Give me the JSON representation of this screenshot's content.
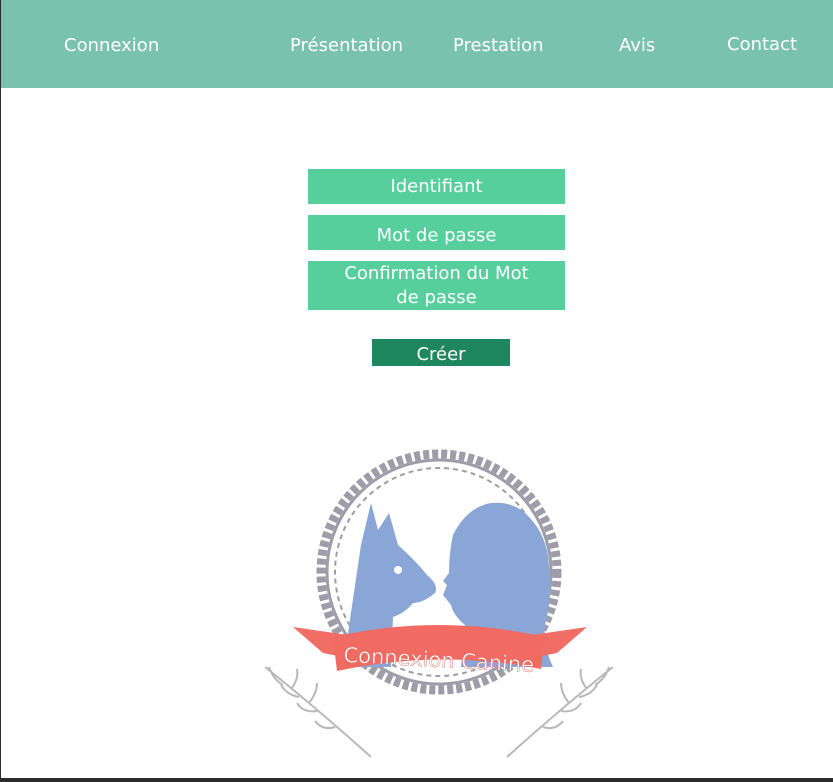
{
  "nav": {
    "items": [
      "Connexion",
      "Présentation",
      "Prestation",
      "Avis",
      "Contact"
    ]
  },
  "form": {
    "identifiant": "Identifiant",
    "mot_de_passe": "Mot de passe",
    "confirmation": "Confirmation du Mot de passe",
    "submit_label": "Créer"
  },
  "logo": {
    "text": "Connexion Canine"
  },
  "colors": {
    "nav_bg": "#79c2ad",
    "field_bg": "#57cf9d",
    "button_bg": "#1e875f",
    "logo_blue": "#8aa6d6",
    "logo_ribbon": "#f06e63",
    "logo_frame": "#9d9ca8"
  }
}
